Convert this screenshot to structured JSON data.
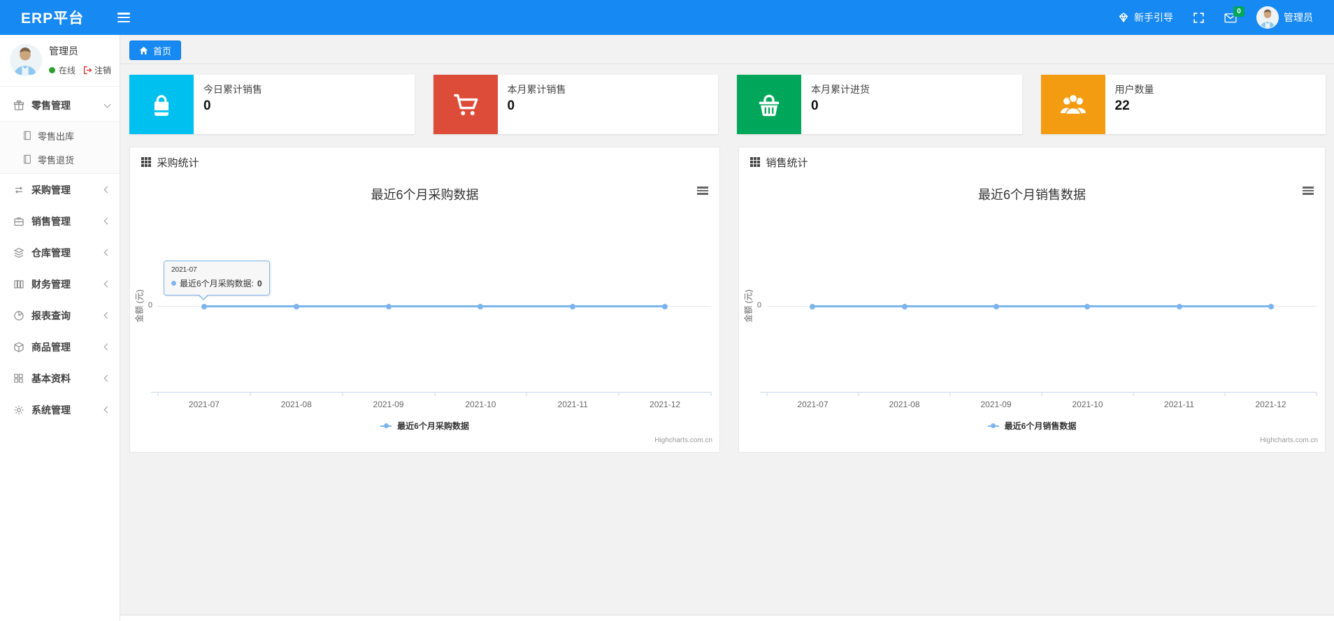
{
  "colors": {
    "accent_blue": "#1789f2",
    "series_blue": "#7cb5ec",
    "card_cyan": "#00c0ef",
    "card_red": "#dd4b39",
    "card_green": "#00a65a",
    "card_orange": "#f39c12",
    "badge_green": "#00a65a"
  },
  "navbar": {
    "brand": "ERP平台",
    "guide": "新手引导",
    "message_count": "0",
    "user": "管理员"
  },
  "sidebar": {
    "user": {
      "name": "管理员",
      "status": "在线",
      "logout": "注销"
    },
    "menu": [
      {
        "label": "零售管理",
        "icon": "gift-icon",
        "state": "expanded",
        "children": [
          {
            "label": "零售出库",
            "icon": "journal-icon"
          },
          {
            "label": "零售退货",
            "icon": "journal-icon"
          }
        ]
      },
      {
        "label": "采购管理",
        "icon": "exchange-icon"
      },
      {
        "label": "销售管理",
        "icon": "briefcase-icon"
      },
      {
        "label": "仓库管理",
        "icon": "layers-icon"
      },
      {
        "label": "财务管理",
        "icon": "ledger-icon"
      },
      {
        "label": "报表查询",
        "icon": "pie-chart-icon"
      },
      {
        "label": "商品管理",
        "icon": "cube-icon"
      },
      {
        "label": "基本资料",
        "icon": "grid-icon"
      },
      {
        "label": "系统管理",
        "icon": "gear-icon"
      }
    ]
  },
  "breadcrumb": {
    "home": "首页"
  },
  "stat_cards": [
    {
      "label": "今日累计销售",
      "value": "0",
      "icon": "shopping-bag-icon",
      "color": "#00c0ef"
    },
    {
      "label": "本月累计销售",
      "value": "0",
      "icon": "shopping-cart-icon",
      "color": "#dd4b39"
    },
    {
      "label": "本月累计进货",
      "value": "0",
      "icon": "shopping-basket-icon",
      "color": "#00a65a"
    },
    {
      "label": "用户数量",
      "value": "22",
      "icon": "users-icon",
      "color": "#f39c12"
    }
  ],
  "chart_data": [
    {
      "type": "line",
      "panel_title": "采购统计",
      "title": "最近6个月采购数据",
      "categories": [
        "2021-07",
        "2021-08",
        "2021-09",
        "2021-10",
        "2021-11",
        "2021-12"
      ],
      "series": [
        {
          "name": "最近6个月采购数据",
          "values": [
            0,
            0,
            0,
            0,
            0,
            0
          ],
          "color": "#7cb5ec"
        }
      ],
      "xlabel": "",
      "ylabel": "金额 (元)",
      "ytick": "0",
      "ylim": [
        -1,
        1
      ],
      "grid": "zero-line-only",
      "legend_position": "bottom",
      "credits": "Highcharts.com.cn",
      "tooltip": {
        "header": "2021-07",
        "label": "最近6个月采购数据:",
        "value": "0"
      }
    },
    {
      "type": "line",
      "panel_title": "销售统计",
      "title": "最近6个月销售数据",
      "categories": [
        "2021-07",
        "2021-08",
        "2021-09",
        "2021-10",
        "2021-11",
        "2021-12"
      ],
      "series": [
        {
          "name": "最近6个月销售数据",
          "values": [
            0,
            0,
            0,
            0,
            0,
            0
          ],
          "color": "#7cb5ec"
        }
      ],
      "xlabel": "",
      "ylabel": "金额 (元)",
      "ytick": "0",
      "ylim": [
        -1,
        1
      ],
      "grid": "zero-line-only",
      "legend_position": "bottom",
      "credits": "Highcharts.com.cn"
    }
  ]
}
